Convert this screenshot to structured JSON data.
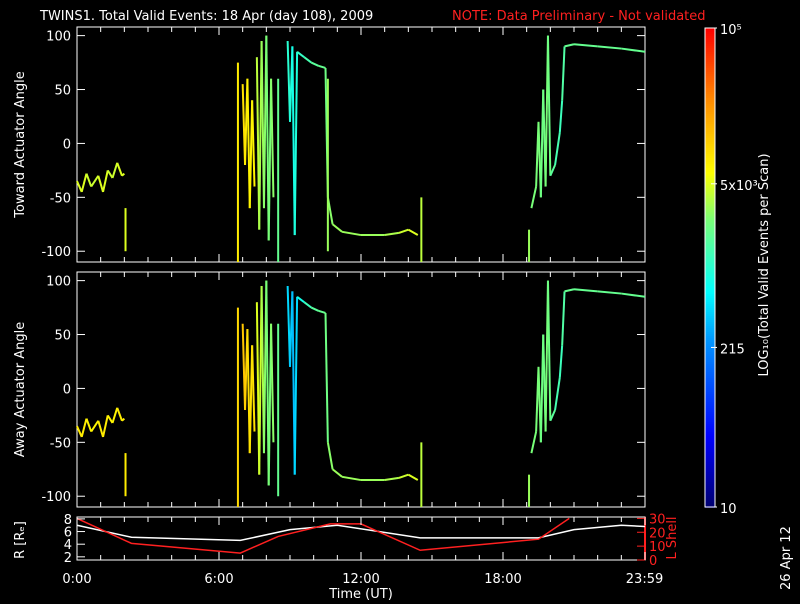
{
  "title": "TWINS1. Total Valid Events: 18 Apr (day 108), 2009",
  "note": "NOTE: Data Preliminary - Not validated",
  "date_stamp": "26 Apr 12",
  "colors": {
    "background": "#000000",
    "axes": "#ffffff",
    "note": "#ff2020",
    "lshell": "#ff2020",
    "radius": "#ffffff"
  },
  "chart_data": [
    {
      "type": "line",
      "name": "toward",
      "ylabel": "Toward Actuator Angle",
      "ylim": [
        -110,
        108
      ],
      "yticks": [
        {
          "v": 100,
          "label": "100"
        },
        {
          "v": 50,
          "label": "50"
        },
        {
          "v": 0,
          "label": "0"
        },
        {
          "v": -50,
          "label": "-50"
        },
        {
          "v": -100,
          "label": "-100"
        }
      ],
      "xlim": [
        0,
        24
      ],
      "traces": [
        {
          "points": [
            [
              0,
              -35,
              3.7
            ],
            [
              0.2,
              -45,
              3.7
            ],
            [
              0.4,
              -28,
              3.7
            ],
            [
              0.6,
              -40,
              3.6
            ],
            [
              0.9,
              -30,
              3.7
            ],
            [
              1.1,
              -45,
              3.7
            ],
            [
              1.3,
              -25,
              3.7
            ],
            [
              1.5,
              -32,
              3.6
            ],
            [
              1.7,
              -18,
              3.7
            ],
            [
              1.9,
              -30,
              3.7
            ],
            [
              2.0,
              -28,
              3.7
            ]
          ]
        },
        {
          "points": [
            [
              7.0,
              55,
              4.0
            ],
            [
              7.1,
              -20,
              3.9
            ],
            [
              7.2,
              60,
              3.9
            ],
            [
              7.3,
              -60,
              3.8
            ],
            [
              7.4,
              40,
              3.9
            ],
            [
              7.5,
              -40,
              3.8
            ]
          ]
        },
        {
          "points": [
            [
              7.6,
              80,
              3.6
            ],
            [
              7.7,
              -80,
              3.6
            ],
            [
              7.8,
              95,
              3.5
            ],
            [
              7.9,
              -60,
              3.5
            ],
            [
              8.0,
              100,
              3.4
            ],
            [
              8.1,
              -90,
              3.4
            ],
            [
              8.2,
              60,
              3.4
            ],
            [
              8.3,
              -50,
              3.5
            ]
          ]
        },
        {
          "points": [
            [
              8.9,
              95,
              3.0
            ],
            [
              9.0,
              20,
              3.0
            ],
            [
              9.1,
              90,
              2.9
            ],
            [
              9.2,
              -85,
              2.9
            ],
            [
              9.3,
              85,
              3.0
            ],
            [
              9.6,
              80,
              3.1
            ],
            [
              9.9,
              75,
              3.2
            ],
            [
              10.2,
              72,
              3.3
            ],
            [
              10.5,
              70,
              3.3
            ],
            [
              10.6,
              -50,
              3.4
            ],
            [
              10.8,
              -75,
              3.5
            ],
            [
              11.2,
              -82,
              3.5
            ],
            [
              12,
              -85,
              3.5
            ],
            [
              13,
              -85,
              3.5
            ],
            [
              13.6,
              -83,
              3.6
            ],
            [
              14.0,
              -80,
              3.7
            ],
            [
              14.4,
              -85,
              3.7
            ]
          ]
        },
        {
          "points": [
            [
              19.2,
              -60,
              3.4
            ],
            [
              19.4,
              -40,
              3.4
            ],
            [
              19.5,
              20,
              3.4
            ],
            [
              19.6,
              -50,
              3.4
            ],
            [
              19.7,
              50,
              3.3
            ],
            [
              19.8,
              -40,
              3.4
            ],
            [
              19.9,
              100,
              3.4
            ],
            [
              20.0,
              -30,
              3.3
            ],
            [
              20.2,
              -20,
              3.2
            ],
            [
              20.4,
              10,
              3.1
            ],
            [
              20.5,
              40,
              3.1
            ],
            [
              20.6,
              90,
              3.3
            ],
            [
              21,
              92,
              3.3
            ],
            [
              22,
              90,
              3.3
            ],
            [
              23,
              88,
              3.3
            ],
            [
              24,
              85,
              3.3
            ]
          ]
        }
      ],
      "spikes": [
        [
          2.05,
          -60,
          -100,
          3.7
        ],
        [
          6.8,
          75,
          -110,
          3.9
        ],
        [
          14.55,
          -50,
          -110,
          3.6
        ],
        [
          19.1,
          -80,
          -110,
          3.5
        ],
        [
          8.5,
          60,
          -110,
          3.3
        ],
        [
          10.6,
          60,
          -100,
          3.5
        ]
      ]
    },
    {
      "type": "line",
      "name": "away",
      "ylabel": "Away Actuator Angle",
      "ylim": [
        -110,
        108
      ],
      "yticks": [
        {
          "v": 100,
          "label": "100"
        },
        {
          "v": 50,
          "label": "50"
        },
        {
          "v": 0,
          "label": "0"
        },
        {
          "v": -50,
          "label": "-50"
        },
        {
          "v": -100,
          "label": "-100"
        }
      ],
      "xlim": [
        0,
        24
      ],
      "traces": [
        {
          "points": [
            [
              0,
              -35,
              3.9
            ],
            [
              0.2,
              -45,
              3.9
            ],
            [
              0.4,
              -28,
              3.9
            ],
            [
              0.6,
              -40,
              3.8
            ],
            [
              0.9,
              -30,
              3.9
            ],
            [
              1.1,
              -45,
              3.9
            ],
            [
              1.3,
              -25,
              3.9
            ],
            [
              1.5,
              -32,
              3.8
            ],
            [
              1.7,
              -18,
              3.9
            ],
            [
              1.9,
              -30,
              3.9
            ],
            [
              2.0,
              -28,
              3.9
            ]
          ]
        },
        {
          "points": [
            [
              7.0,
              60,
              4.1
            ],
            [
              7.1,
              -20,
              4.1
            ],
            [
              7.2,
              55,
              4.0
            ],
            [
              7.3,
              -60,
              3.9
            ],
            [
              7.4,
              40,
              4.0
            ],
            [
              7.5,
              -40,
              3.9
            ]
          ]
        },
        {
          "points": [
            [
              7.6,
              80,
              3.7
            ],
            [
              7.7,
              -80,
              3.7
            ],
            [
              7.8,
              95,
              3.6
            ],
            [
              7.9,
              -60,
              3.5
            ],
            [
              8.0,
              100,
              3.4
            ],
            [
              8.1,
              -90,
              3.4
            ],
            [
              8.2,
              60,
              3.4
            ],
            [
              8.3,
              -50,
              3.5
            ]
          ]
        },
        {
          "points": [
            [
              8.9,
              95,
              2.7
            ],
            [
              9.0,
              20,
              2.6
            ],
            [
              9.1,
              90,
              2.6
            ],
            [
              9.2,
              -80,
              2.5
            ],
            [
              9.3,
              85,
              2.8
            ],
            [
              9.6,
              80,
              3.0
            ],
            [
              9.9,
              75,
              3.2
            ],
            [
              10.2,
              72,
              3.3
            ],
            [
              10.5,
              70,
              3.3
            ],
            [
              10.6,
              -50,
              3.4
            ],
            [
              10.8,
              -75,
              3.5
            ],
            [
              11.2,
              -82,
              3.5
            ],
            [
              12,
              -85,
              3.5
            ],
            [
              13,
              -85,
              3.5
            ],
            [
              13.6,
              -83,
              3.6
            ],
            [
              14.0,
              -80,
              3.7
            ],
            [
              14.4,
              -85,
              3.7
            ]
          ]
        },
        {
          "points": [
            [
              19.2,
              -60,
              3.4
            ],
            [
              19.4,
              -40,
              3.4
            ],
            [
              19.5,
              20,
              3.4
            ],
            [
              19.6,
              -50,
              3.4
            ],
            [
              19.7,
              50,
              3.3
            ],
            [
              19.8,
              -40,
              3.4
            ],
            [
              19.9,
              100,
              3.4
            ],
            [
              20.0,
              -30,
              3.3
            ],
            [
              20.2,
              -20,
              3.2
            ],
            [
              20.4,
              10,
              3.1
            ],
            [
              20.5,
              40,
              3.1
            ],
            [
              20.6,
              90,
              3.3
            ],
            [
              21,
              92,
              3.3
            ],
            [
              22,
              90,
              3.3
            ],
            [
              23,
              88,
              3.3
            ],
            [
              24,
              85,
              3.3
            ]
          ]
        }
      ],
      "spikes": [
        [
          2.05,
          -60,
          -100,
          3.9
        ],
        [
          6.8,
          75,
          -110,
          4.0
        ],
        [
          14.55,
          -50,
          -110,
          3.6
        ],
        [
          19.1,
          -80,
          -110,
          3.5
        ],
        [
          8.5,
          60,
          -100,
          3.3
        ]
      ]
    },
    {
      "type": "line",
      "name": "orbit",
      "ylabel": "R [Rₑ]",
      "y2label": "L Shell",
      "ylim": [
        1.5,
        8.3
      ],
      "y2lim": [
        0,
        31
      ],
      "yticks": [
        {
          "v": 8,
          "label": "8"
        },
        {
          "v": 6,
          "label": "6"
        },
        {
          "v": 4,
          "label": "4"
        },
        {
          "v": 2,
          "label": "2"
        }
      ],
      "y2ticks": [
        {
          "v": 30,
          "label": "30"
        },
        {
          "v": 20,
          "label": "20"
        },
        {
          "v": 10,
          "label": "10"
        },
        {
          "v": 0,
          "label": "0"
        }
      ],
      "xlabel": "Time (UT)",
      "xticks": [
        {
          "v": 0,
          "label": "0:00"
        },
        {
          "v": 6,
          "label": "6:00"
        },
        {
          "v": 12,
          "label": "12:00"
        },
        {
          "v": 18,
          "label": "18:00"
        },
        {
          "v": 23.98,
          "label": "23:59"
        }
      ],
      "series": [
        {
          "name": "R",
          "axis": "left",
          "x": [
            0,
            2.3,
            6.9,
            9,
            11,
            14.5,
            19.5,
            21,
            23,
            24
          ],
          "y": [
            7,
            5.1,
            4.6,
            6.3,
            7,
            5,
            5,
            6.3,
            7,
            6.8
          ]
        },
        {
          "name": "L Shell",
          "axis": "right",
          "x": [
            0,
            2.3,
            6.9,
            8.5,
            10.7,
            12,
            14.5,
            19.5,
            20.8
          ],
          "y": [
            30,
            12,
            5,
            17,
            26,
            26,
            7,
            15,
            30
          ]
        }
      ]
    }
  ],
  "colorbar": {
    "label": "LOG₁₀(Total Valid Events per Scan)",
    "range": [
      10,
      100000
    ],
    "ticks": [
      {
        "v": 100000,
        "label": "10⁵"
      },
      {
        "v": 5000,
        "label": "5x10³"
      },
      {
        "v": 215,
        "label": "215"
      },
      {
        "v": 10,
        "label": "10"
      }
    ]
  }
}
